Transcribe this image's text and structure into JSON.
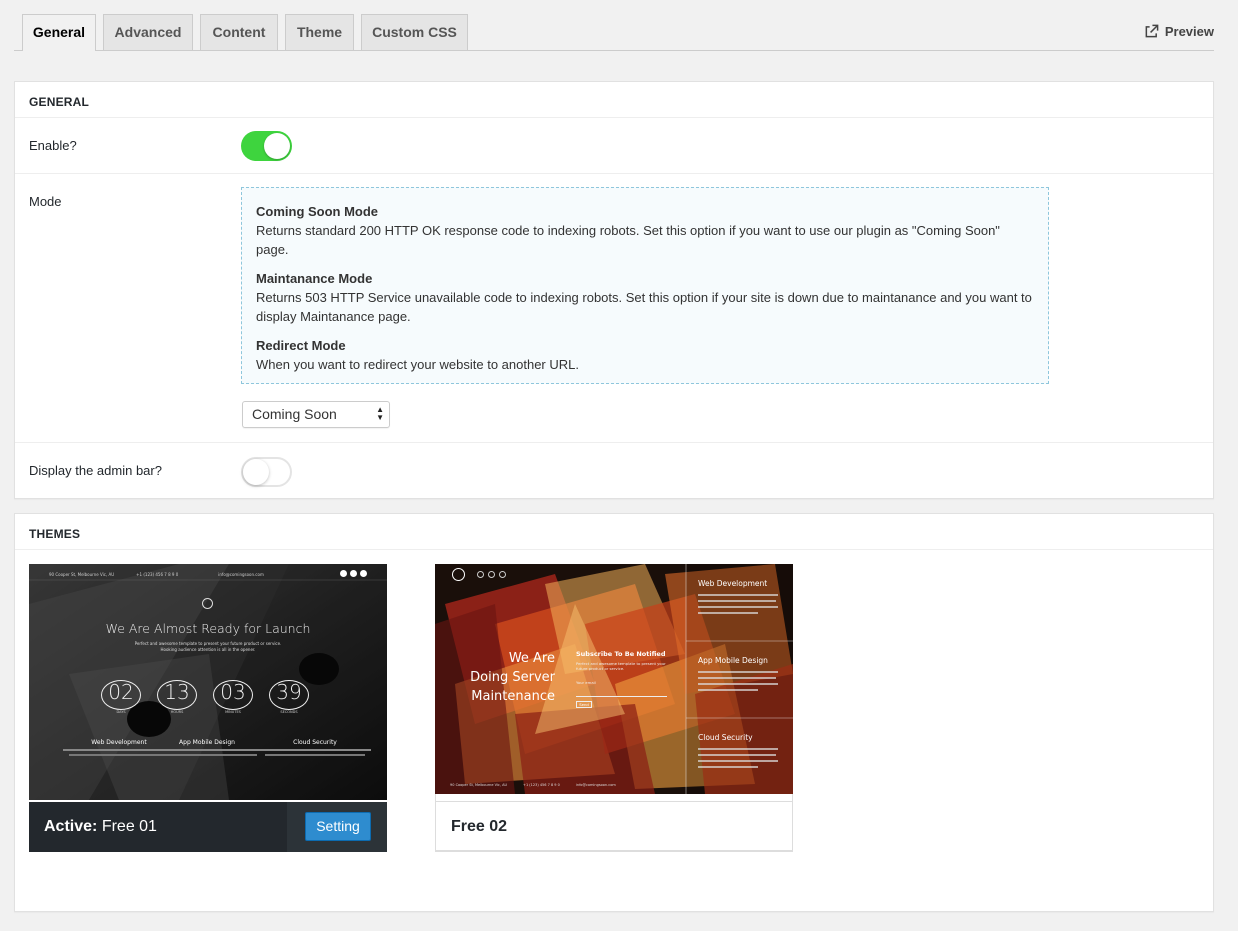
{
  "tabs": [
    {
      "label": "General",
      "active": true
    },
    {
      "label": "Advanced",
      "active": false
    },
    {
      "label": "Content",
      "active": false
    },
    {
      "label": "Theme",
      "active": false
    },
    {
      "label": "Custom CSS",
      "active": false
    }
  ],
  "preview_label": "Preview",
  "general": {
    "heading": "GENERAL",
    "enable_label": "Enable?",
    "enable_on": true,
    "mode_label": "Mode",
    "modes": [
      {
        "title": "Coming Soon Mode",
        "desc": "Returns standard 200 HTTP OK response code to indexing robots. Set this option if you want to use our plugin as \"Coming Soon\" page."
      },
      {
        "title": "Maintanance Mode",
        "desc": "Returns 503 HTTP Service unavailable code to indexing robots. Set this option if your site is down due to maintanance and you want to display Maintanance page."
      },
      {
        "title": "Redirect Mode",
        "desc": "When you want to redirect your website to another URL."
      }
    ],
    "mode_select_value": "Coming Soon",
    "admin_bar_label": "Display the admin bar?",
    "admin_bar_on": false
  },
  "themes": {
    "heading": "THEMES",
    "items": [
      {
        "active_prefix": "Active:",
        "name": "Free 01",
        "setting_label": "Setting",
        "preview": {
          "headline": "We Are Almost Ready for Launch",
          "subline1": "Perfect and awesome template to present your future product or service.",
          "subline2": "Hooking audience attention is all in the opener.",
          "countdown": [
            {
              "value": "02",
              "unit": "DAYS"
            },
            {
              "value": "13",
              "unit": "HOURS"
            },
            {
              "value": "03",
              "unit": "MINUTES"
            },
            {
              "value": "39",
              "unit": "SECONDS"
            }
          ],
          "features": [
            "Web Development",
            "App Mobile Design",
            "Cloud Security"
          ],
          "topbar": [
            "90 Cooper St, Melbourne Vic, AU",
            "+1 (123) 456 7 8 9 0",
            "info@comingsoon.com"
          ]
        }
      },
      {
        "name": "Free 02",
        "preview": {
          "headline": [
            "We Are",
            "Doing Server",
            "Maintenance"
          ],
          "subscribe_title": "Subscribe To Be Notified",
          "subscribe_text": "Perfect and awesome template to present your future product or service.",
          "email_label": "Your email",
          "send_label": "Send",
          "features": [
            "Web Development",
            "App Mobile Design",
            "Cloud Security"
          ],
          "footer": [
            "90 Cooper St, Melbourne Vic, AU",
            "+1 (123) 456 7 8 9 0",
            "info@comingsoon.com"
          ]
        }
      }
    ]
  }
}
